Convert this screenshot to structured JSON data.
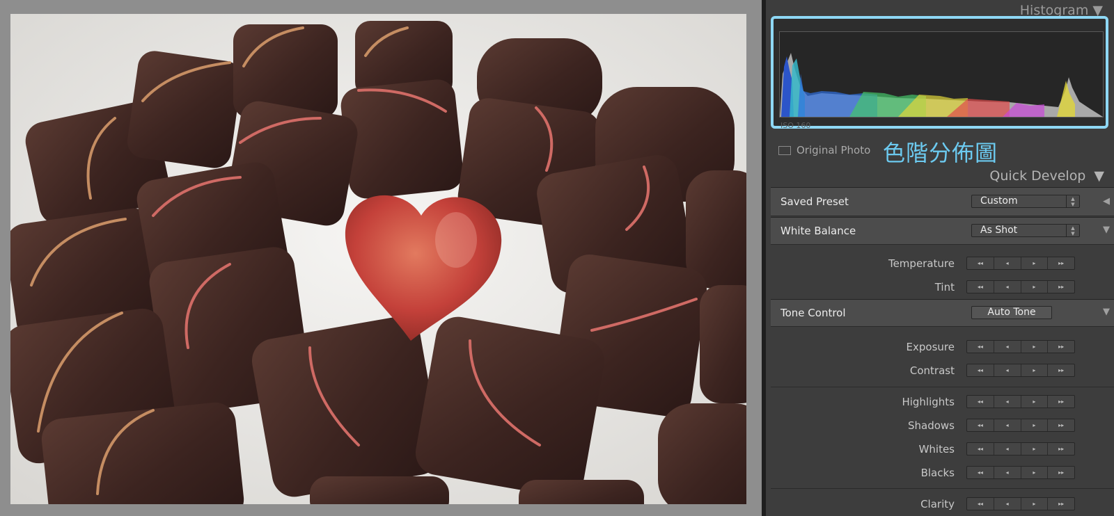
{
  "panel": {
    "histogram_title": "Histogram",
    "histogram_footer": "ISO 160",
    "original_photo_label": "Original Photo",
    "annotation": "色階分佈圖",
    "quick_develop_title": "Quick Develop"
  },
  "saved_preset": {
    "label": "Saved Preset",
    "value": "Custom"
  },
  "white_balance": {
    "label": "White Balance",
    "value": "As Shot"
  },
  "wb_controls": [
    "Temperature",
    "Tint"
  ],
  "tone_control": {
    "label": "Tone Control",
    "button": "Auto Tone"
  },
  "tone_controls_1": [
    "Exposure",
    "Contrast"
  ],
  "tone_controls_2": [
    "Highlights",
    "Shadows",
    "Whites",
    "Blacks"
  ],
  "tone_controls_3": [
    "Clarity"
  ],
  "stepper": [
    "◂◂",
    "◂",
    "▸",
    "▸▸"
  ],
  "colors": {
    "accent": "#8ed8f5",
    "annotation": "#6ccaf0",
    "panel": "#3d3d3d"
  }
}
